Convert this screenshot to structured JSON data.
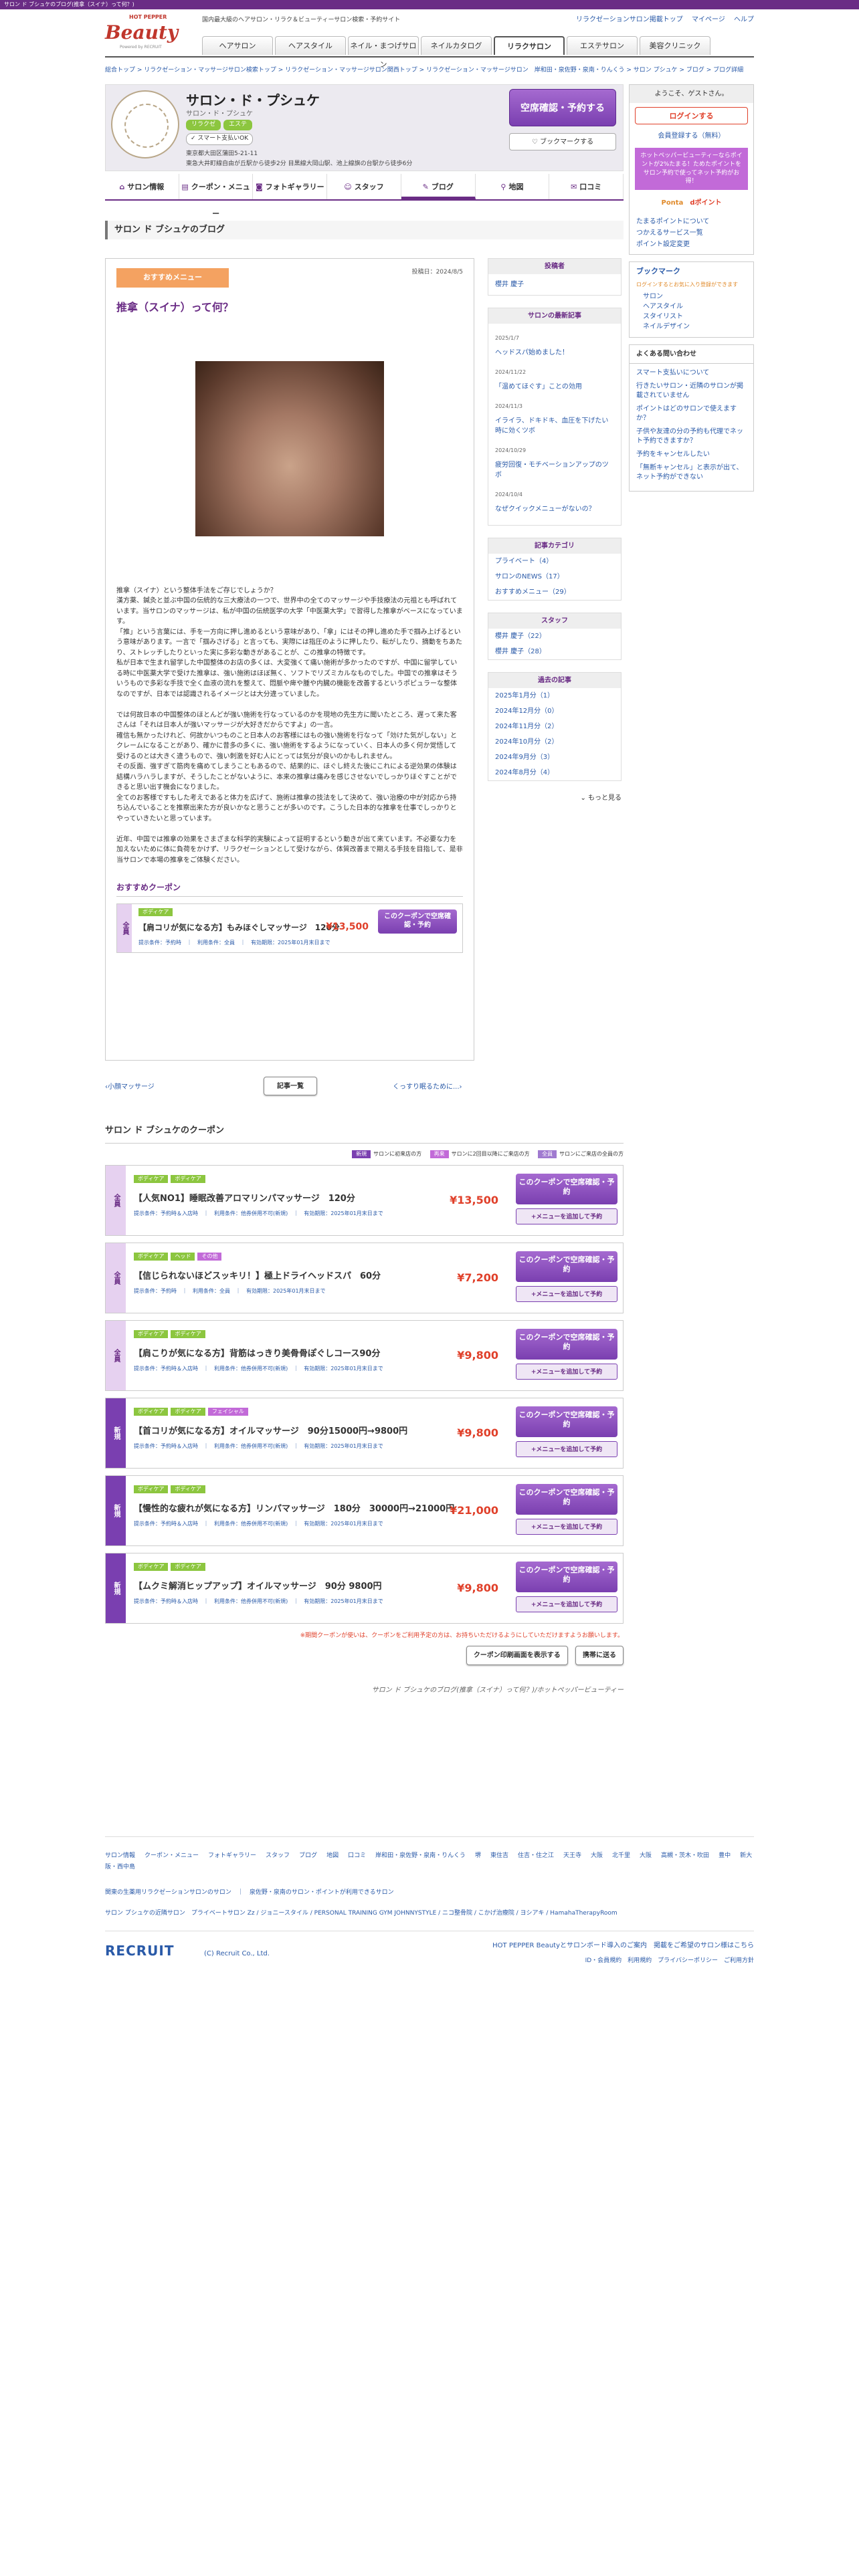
{
  "topbar": "サロン ド ブシュケのブログ(推拿（スイナ）って何？)",
  "header": {
    "tagline": "国内最大級のヘアサロン・リラク＆ビューティーサロン検索・予約サイト",
    "links": [
      "リラクゼーションサロン掲載トップ",
      "マイページ",
      "ヘルプ"
    ],
    "logo_hp": "HOT PEPPER",
    "logo_b": "Beauty",
    "logo_pw": "Powered by RECRUIT",
    "tabs": [
      "ヘアサロン",
      "ヘアスタイル",
      "ネイル・まつげサロン",
      "ネイルカタログ",
      "リラクサロン",
      "エステサロン",
      "美容クリニック"
    ],
    "active_tab": 4
  },
  "breadcrumb": "総合トップ > リラクゼーション・マッサージサロン検索トップ > リラクゼーション・マッサージサロン関西トップ > リラクゼーション・マッサージサロン　岸和田・泉佐野・泉南・りんくう > サロン プシュケ > ブログ > ブログ詳細",
  "salon": {
    "name": "サロン・ド・プシュケ",
    "kana": "サロン・ド・プシュケ",
    "tags": [
      "リラクゼ",
      "エステ"
    ],
    "payment": "スマート支払いOK",
    "address_1": "東京都大田区蒲田5-21-11",
    "address_2": "東急大井町線自由が丘駅から徒歩2分 目黒線大岡山駅、池上線旗の台駅から徒歩6分",
    "book_button": "空席確認・予約する",
    "fav_button": "ブックマークする"
  },
  "salon_nav": [
    "サロン情報",
    "クーポン・メニュー",
    "フォトギャラリー",
    "スタッフ",
    "ブログ",
    "地図",
    "口コミ"
  ],
  "salon_nav_active": 4,
  "blog_title": "サロン ド ブシュケのブログ",
  "entry": {
    "badge": "おすすめメニュー",
    "date": "投稿日：2024/8/5",
    "title": "推拿（スイナ）って何？",
    "body": "推拿（スイナ）という整体手法をご存じでしょうか？\n漢方薬、鍼灸と並ぶ中国の伝統的な三大療法の一つで、世界中の全てのマッサージや手技療法の元祖とも呼ばれています。当サロンのマッサージは、私が中国の伝統医学の大学「中医薬大学」で習得した推拿がベースになっています。\n「推」という言葉には、手を一方向に押し進めるという意味があり、「拿」にはその押し進めた手で掴み上げるという意味があります。一言で「掴みさげる」と言っても、実際には指圧のように押したり、転がしたり、摘動をちあたり、ストレッチしたりといった実に多彩な動きがあることが、この推拿の特徴です。\n私が日本で生まれ留学した中国整体のお店の多くは、大変強くて痛い施術が多かったのですが、中国に留学している時に中医薬大学で受けた推拿は、強い施術はほぼ無く、ソフトでリズミカルなものでした。中国での推拿はそういうもので多彩な手技で全く血液の流れを整えて、悶脈や痺や腫や内臓の機能を改善するというポピュラーな整体なのですが、日本では認識されるイメージとは大分違っていました。\n\nでは何故日本の中国整体のほとんどが強い施術を行なっているのかを現地の先生方に聞いたところ、遅って来た客さんは「それは日本人が強いマッサージが大好きだからですよ」の一言。\n確信も無かったけれど、何故かいつものこと日本人のお客様にはもの強い施術を行なって「効けた気がしない」とクレームになることがあり、確かに昔多の多くに、強い施術をするようになっていく、日本人の多く何か覚悟して受けるのとは大きく違うもので、強い刺激を好む人にとっては気分が良いのかもしれません。\nその反面、強すぎて筋肉を痛めてしまうこともあるので、結果的に、ほぐし終えた後にこれによる逆効果の体験は結構ハラハラしますが、そうしたことがないように、本来の推拿は痛みを感じさせないでしっかりほぐすことができると思い出す機会になりました。\n全てのお客様ですもした考えであると体力を広げて、施術は推拿の技法をして決めて、強い治療の中が対応から持ち込んでいることを推察出来た方が良いかなと思うことが多いのです。こうした日本的な推拿を仕事でしっかりとやっていきたいと思っています。\n\n近年、中国では推拿の効果をさまざまな科学的実験によって証明するという動きが出て来ています。不必要な力を加えないために体に負荷をかけず、リラクゼーションとして受けながら、体質改善まで期える手技を目指して、是非当サロンで本場の推拿をご体験ください。",
    "coupon_heading": "おすすめクーポン",
    "coupon": {
      "side": "全員",
      "tags": [
        "ボディケア"
      ],
      "name": "【肩コリが気になる方】もみほぐしマッサージ　120分",
      "price": "¥13,500",
      "meta": "提示条件：予約時　｜　利用条件：全員　｜　有効期限：2025年01月末日まで",
      "button": "このクーポンで空席確認・予約"
    }
  },
  "right": {
    "author_h": "投稿者",
    "author": "櫻井 慶子",
    "recent_h": "サロンの最新記事",
    "recent": [
      {
        "d": "2025/1/7",
        "t": "ヘッドスパ始めました！"
      },
      {
        "d": "2024/11/22",
        "t": "「温めてほぐす」ことの効用"
      },
      {
        "d": "2024/11/3",
        "t": "イライラ、ドキドキ、血圧を下げたい時に効くツボ"
      },
      {
        "d": "2024/10/29",
        "t": "疲労回復・モチベーションアップのツボ"
      },
      {
        "d": "2024/10/4",
        "t": "なぜクイックメニューがないの？"
      }
    ],
    "cat_h": "記事カテゴリ",
    "cats": [
      "プライベート（4）",
      "サロンのNEWS（17）",
      "おすすめメニュー（29）"
    ],
    "staff_h": "スタッフ",
    "staff": [
      "櫻井 慶子（22）",
      "櫻井 慶子（28）"
    ],
    "past_h": "過去の記事",
    "past": [
      "2025年1月分（1）",
      "2024年12月分（0）",
      "2024年11月分（2）",
      "2024年10月分（2）",
      "2024年9月分（3）",
      "2024年8月分（4）"
    ],
    "more": "もっと見る"
  },
  "pager": {
    "prev": "小顔マッサージ",
    "list": "記事一覧",
    "next": "くっすり眠るために..."
  },
  "coupons": {
    "heading": "サロン ド ブシュケのクーポン",
    "legend": [
      {
        "k": "新規",
        "t": "サロンに初来店の方",
        "c": "#7a3fb0"
      },
      {
        "k": "再来",
        "t": "サロンに2回目以降にご来店の方",
        "c": "#c26ad8"
      },
      {
        "k": "全員",
        "t": "サロンにご来店の全員の方",
        "c": "#a07ad0"
      }
    ],
    "items": [
      {
        "side": "全員",
        "tags": [
          "ボディケア",
          "ボディケア"
        ],
        "name": "【人気NO1】睡眠改善アロマリンパマッサージ　120分",
        "price": "¥13,500",
        "meta": "提示条件：予約時＆入店時　｜　利用条件：他券併用不可(新規)　｜　有効期限：2025年01月末日まで"
      },
      {
        "side": "全員",
        "tags": [
          "ボディケア",
          "ヘッド",
          "その他"
        ],
        "name": "【信じられないほどスッキリ！】極上ドライヘッドスパ　60分",
        "price": "¥7,200",
        "meta": "提示条件：予約時　｜　利用条件：全員　｜　有効期限：2025年01月末日まで"
      },
      {
        "side": "全員",
        "tags": [
          "ボディケア",
          "ボディケア"
        ],
        "name": "【肩こりが気になる方】背筋はっきり美骨骨ぽぐしコース90分",
        "price": "¥9,800",
        "meta": "提示条件：予約時＆入店時　｜　利用条件：他券併用不可(新規)　｜　有効期限：2025年01月末日まで"
      },
      {
        "side": "新規",
        "tags": [
          "ボディケア",
          "ボディケア",
          "フェイシャル"
        ],
        "name": "【首コリが気になる方】オイルマッサージ　90分15000円→9800円",
        "price": "¥9,800",
        "meta": "提示条件：予約時＆入店時　｜　利用条件：他券併用不可(新規)　｜　有効期限：2025年01月末日まで"
      },
      {
        "side": "新規",
        "tags": [
          "ボディケア",
          "ボディケア"
        ],
        "name": "【慢性的な疲れが気になる方】リンパマッサージ　180分　30000円→21000円",
        "price": "¥21,000",
        "meta": "提示条件：予約時＆入店時　｜　利用条件：他券併用不可(新規)　｜　有効期限：2025年01月末日まで"
      },
      {
        "side": "新規",
        "tags": [
          "ボディケア",
          "ボディケア"
        ],
        "name": "【ムクミ解消ヒップアップ】オイルマッサージ　90分 9800円",
        "price": "¥9,800",
        "meta": "提示条件：予約時＆入店時　｜　利用条件：他券併用不可(新規)　｜　有効期限：2025年01月末日まで"
      }
    ],
    "btn": "このクーポンで空席確認・予約",
    "add": "+メニューを追加して予約",
    "note": "※期間クーポンが使いは、クーポンをご利用予定の方は、お持ちいただけるようにしていただけますようお願いします。",
    "print": "クーポン印刷画面を表示する",
    "mobile": "携帯に送る"
  },
  "footer_title": "サロン ド ブシュケのブログ(推拿（スイナ）って何？)/ホットペッパービューティー",
  "sidebar": {
    "welcome": "ようこそ、ゲストさん。",
    "login": "ログインする",
    "register": "会員登録する（無料）",
    "banner": "ホットペッパービューティーならポイントが2%たまる！ためたポイントをサロン予約で使ってネット予約がお得！",
    "pt_a": "Ponta",
    "pt_b": "dポイント",
    "links": [
      "たまるポイントについて",
      "つかえるサービス一覧",
      "ポイント設定変更"
    ],
    "bm_h": "ブックマーク",
    "bm_note": "ログインするとお気に入り登録ができます",
    "bm": [
      "サロン",
      "ヘアスタイル",
      "スタイリスト",
      "ネイルデザイン"
    ],
    "faq_h": "よくある問い合わせ",
    "faq": [
      "スマート支払いについて",
      "行きたいサロン・近隣のサロンが掲載されていません",
      "ポイントはどのサロンで使えますか？",
      "子供や友達の分の予約も代理でネット予約できますか？",
      "予約をキャンセルしたい",
      "「無断キャンセル」と表示が出て、ネット予約ができない"
    ]
  },
  "gfooter": {
    "row1": [
      "サロン情報",
      "クーポン・メニュー",
      "フォトギャラリー",
      "スタッフ",
      "ブログ",
      "地図",
      "口コミ",
      "岸和田・泉佐野・泉南・りんくう",
      "堺",
      "東住吉",
      "住吉・住之江",
      "天王寺",
      "大阪",
      "北千里",
      "大阪",
      "高槻・茨木・吹田",
      "豊中",
      "新大阪・西中島"
    ],
    "row2": "関東の生薬用リラクゼーションサロンのサロン　｜　泉佐野・泉南のサロン・ポイントが利用できるサロン",
    "row3": "サロン プシュケの近隣サロン　プライベートサロン Zz / ジョニースタイル / PERSONAL TRAINING GYM JOHNNYSTYLE / ニコ整骨院 / こかげ治療院 / ヨシアキ / HamahaTherapyRoom",
    "logo": "RECRUIT",
    "company": "(C) Recruit Co., Ltd.",
    "r1": "HOT PEPPER Beautyとサロンボード導入のご案内　掲載をご希望のサロン様はこちら",
    "r2": "ID・会員規約　利用規約　プライバシーポリシー　ご利用方針"
  }
}
